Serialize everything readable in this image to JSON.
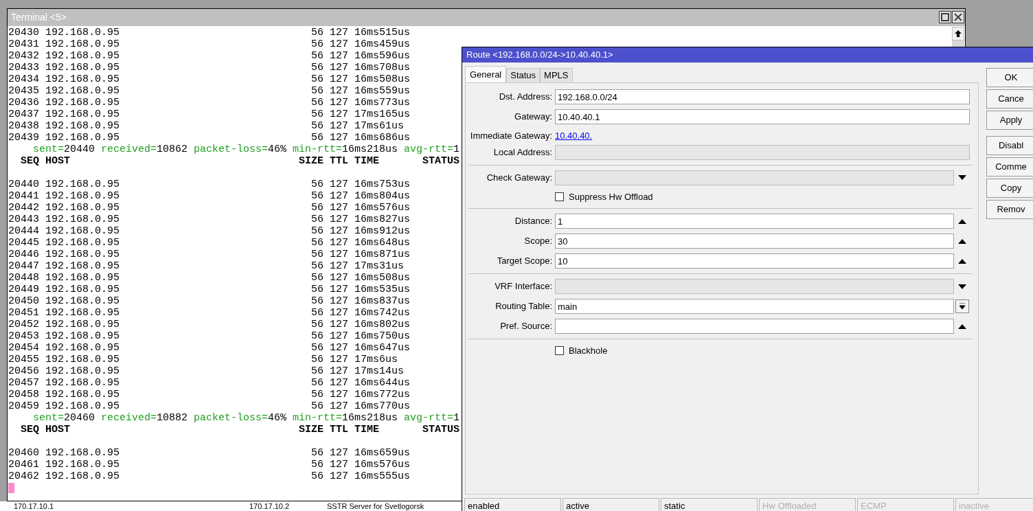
{
  "terminal": {
    "title": "Terminal <5>",
    "lines": [
      {
        "kind": "ping",
        "seq": "20430",
        "host": "192.168.0.95",
        "size": "56",
        "ttl": "127",
        "time": "16ms515us"
      },
      {
        "kind": "ping",
        "seq": "20431",
        "host": "192.168.0.95",
        "size": "56",
        "ttl": "127",
        "time": "16ms459us"
      },
      {
        "kind": "ping",
        "seq": "20432",
        "host": "192.168.0.95",
        "size": "56",
        "ttl": "127",
        "time": "16ms596us"
      },
      {
        "kind": "ping",
        "seq": "20433",
        "host": "192.168.0.95",
        "size": "56",
        "ttl": "127",
        "time": "16ms708us"
      },
      {
        "kind": "ping",
        "seq": "20434",
        "host": "192.168.0.95",
        "size": "56",
        "ttl": "127",
        "time": "16ms508us"
      },
      {
        "kind": "ping",
        "seq": "20435",
        "host": "192.168.0.95",
        "size": "56",
        "ttl": "127",
        "time": "16ms559us"
      },
      {
        "kind": "ping",
        "seq": "20436",
        "host": "192.168.0.95",
        "size": "56",
        "ttl": "127",
        "time": "16ms773us"
      },
      {
        "kind": "ping",
        "seq": "20437",
        "host": "192.168.0.95",
        "size": "56",
        "ttl": "127",
        "time": "17ms165us"
      },
      {
        "kind": "ping",
        "seq": "20438",
        "host": "192.168.0.95",
        "size": "56",
        "ttl": "127",
        "time": "17ms61us"
      },
      {
        "kind": "ping",
        "seq": "20439",
        "host": "192.168.0.95",
        "size": "56",
        "ttl": "127",
        "time": "16ms686us"
      },
      {
        "kind": "summary",
        "parts": [
          {
            "key": "sent=",
            "value": "20440"
          },
          {
            "key": "received=",
            "value": "10862"
          },
          {
            "key": "packet-loss=",
            "value": "46%"
          },
          {
            "key": "min-rtt=",
            "value": "16ms218us"
          },
          {
            "key": "avg-rtt=",
            "value": "1"
          }
        ]
      },
      {
        "kind": "header",
        "columns": [
          "SEQ",
          "HOST",
          "SIZE",
          "TTL",
          "TIME",
          "STATUS"
        ]
      },
      {
        "kind": "blank"
      },
      {
        "kind": "ping",
        "seq": "20440",
        "host": "192.168.0.95",
        "size": "56",
        "ttl": "127",
        "time": "16ms753us"
      },
      {
        "kind": "ping",
        "seq": "20441",
        "host": "192.168.0.95",
        "size": "56",
        "ttl": "127",
        "time": "16ms804us"
      },
      {
        "kind": "ping",
        "seq": "20442",
        "host": "192.168.0.95",
        "size": "56",
        "ttl": "127",
        "time": "16ms576us"
      },
      {
        "kind": "ping",
        "seq": "20443",
        "host": "192.168.0.95",
        "size": "56",
        "ttl": "127",
        "time": "16ms827us"
      },
      {
        "kind": "ping",
        "seq": "20444",
        "host": "192.168.0.95",
        "size": "56",
        "ttl": "127",
        "time": "16ms912us"
      },
      {
        "kind": "ping",
        "seq": "20445",
        "host": "192.168.0.95",
        "size": "56",
        "ttl": "127",
        "time": "16ms648us"
      },
      {
        "kind": "ping",
        "seq": "20446",
        "host": "192.168.0.95",
        "size": "56",
        "ttl": "127",
        "time": "16ms871us"
      },
      {
        "kind": "ping",
        "seq": "20447",
        "host": "192.168.0.95",
        "size": "56",
        "ttl": "127",
        "time": "17ms31us"
      },
      {
        "kind": "ping",
        "seq": "20448",
        "host": "192.168.0.95",
        "size": "56",
        "ttl": "127",
        "time": "16ms508us"
      },
      {
        "kind": "ping",
        "seq": "20449",
        "host": "192.168.0.95",
        "size": "56",
        "ttl": "127",
        "time": "16ms535us"
      },
      {
        "kind": "ping",
        "seq": "20450",
        "host": "192.168.0.95",
        "size": "56",
        "ttl": "127",
        "time": "16ms837us"
      },
      {
        "kind": "ping",
        "seq": "20451",
        "host": "192.168.0.95",
        "size": "56",
        "ttl": "127",
        "time": "16ms742us"
      },
      {
        "kind": "ping",
        "seq": "20452",
        "host": "192.168.0.95",
        "size": "56",
        "ttl": "127",
        "time": "16ms802us"
      },
      {
        "kind": "ping",
        "seq": "20453",
        "host": "192.168.0.95",
        "size": "56",
        "ttl": "127",
        "time": "16ms750us"
      },
      {
        "kind": "ping",
        "seq": "20454",
        "host": "192.168.0.95",
        "size": "56",
        "ttl": "127",
        "time": "16ms647us"
      },
      {
        "kind": "ping",
        "seq": "20455",
        "host": "192.168.0.95",
        "size": "56",
        "ttl": "127",
        "time": "17ms6us"
      },
      {
        "kind": "ping",
        "seq": "20456",
        "host": "192.168.0.95",
        "size": "56",
        "ttl": "127",
        "time": "17ms14us"
      },
      {
        "kind": "ping",
        "seq": "20457",
        "host": "192.168.0.95",
        "size": "56",
        "ttl": "127",
        "time": "16ms644us"
      },
      {
        "kind": "ping",
        "seq": "20458",
        "host": "192.168.0.95",
        "size": "56",
        "ttl": "127",
        "time": "16ms772us"
      },
      {
        "kind": "ping",
        "seq": "20459",
        "host": "192.168.0.95",
        "size": "56",
        "ttl": "127",
        "time": "16ms770us"
      },
      {
        "kind": "summary",
        "parts": [
          {
            "key": "sent=",
            "value": "20460"
          },
          {
            "key": "received=",
            "value": "10882"
          },
          {
            "key": "packet-loss=",
            "value": "46%"
          },
          {
            "key": "min-rtt=",
            "value": "16ms218us"
          },
          {
            "key": "avg-rtt=",
            "value": "1"
          }
        ]
      },
      {
        "kind": "header",
        "columns": [
          "SEQ",
          "HOST",
          "SIZE",
          "TTL",
          "TIME",
          "STATUS"
        ]
      },
      {
        "kind": "blank"
      },
      {
        "kind": "ping",
        "seq": "20460",
        "host": "192.168.0.95",
        "size": "56",
        "ttl": "127",
        "time": "16ms659us"
      },
      {
        "kind": "ping",
        "seq": "20461",
        "host": "192.168.0.95",
        "size": "56",
        "ttl": "127",
        "time": "16ms576us"
      },
      {
        "kind": "ping",
        "seq": "20462",
        "host": "192.168.0.95",
        "size": "56",
        "ttl": "127",
        "time": "16ms555us"
      },
      {
        "kind": "cursor"
      }
    ]
  },
  "background_row": [
    "170.17.10.1",
    "170.17.10.2",
    "SSTR Server for Svetlogorsk"
  ],
  "dialog": {
    "title": "Route <192.168.0.0/24->10.40.40.1>",
    "tabs": [
      {
        "label": "General",
        "selected": true
      },
      {
        "label": "Status",
        "selected": false
      },
      {
        "label": "MPLS",
        "selected": false
      }
    ],
    "rows": [
      {
        "kind": "field",
        "label": "Dst. Address:",
        "value": "192.168.0.0/24",
        "disabled": false
      },
      {
        "kind": "field",
        "label": "Gateway:",
        "value": "10.40.40.1",
        "disabled": false
      },
      {
        "kind": "link",
        "label": "Immediate Gateway:",
        "value": "10.40.40."
      },
      {
        "kind": "field",
        "label": "Local Address:",
        "disabled": true
      },
      {
        "kind": "separator"
      },
      {
        "kind": "field",
        "label": "Check Gateway:",
        "disabled": true,
        "control": {
          "kind": "down"
        }
      },
      {
        "kind": "checkbox",
        "label": "Suppress Hw Offload",
        "checked": false
      },
      {
        "kind": "separator"
      },
      {
        "kind": "field",
        "label": "Distance:",
        "value": "1",
        "disabled": false,
        "control": {
          "kind": "up"
        }
      },
      {
        "kind": "field",
        "label": "Scope:",
        "value": "30",
        "disabled": false,
        "control": {
          "kind": "up"
        }
      },
      {
        "kind": "field",
        "label": "Target Scope:",
        "value": "10",
        "disabled": false,
        "control": {
          "kind": "up"
        }
      },
      {
        "kind": "separator"
      },
      {
        "kind": "field",
        "label": "VRF Interface:",
        "disabled": true,
        "control": {
          "kind": "down"
        }
      },
      {
        "kind": "field",
        "label": "Routing Table:",
        "value": "main",
        "disabled": false,
        "control": {
          "kind": "menu"
        }
      },
      {
        "kind": "field",
        "label": "Pref. Source:",
        "disabled": false,
        "control": {
          "kind": "up"
        }
      },
      {
        "kind": "separator"
      },
      {
        "kind": "checkbox",
        "label": "Blackhole",
        "checked": false
      }
    ],
    "buttons": [
      {
        "label": "OK"
      },
      {
        "label": "Cance"
      },
      {
        "label": "Apply"
      },
      {
        "label": "Disabl",
        "spaced": true
      },
      {
        "label": "Comme"
      },
      {
        "label": "Copy"
      },
      {
        "label": "Remov"
      }
    ],
    "status_bar": [
      {
        "text": "enabled",
        "disabled": false
      },
      {
        "text": "active",
        "disabled": false
      },
      {
        "text": "static",
        "disabled": false
      },
      {
        "text": "Hw Offloaded",
        "disabled": true
      },
      {
        "text": "ECMP",
        "disabled": true
      },
      {
        "text": "inactive",
        "disabled": true
      }
    ]
  }
}
